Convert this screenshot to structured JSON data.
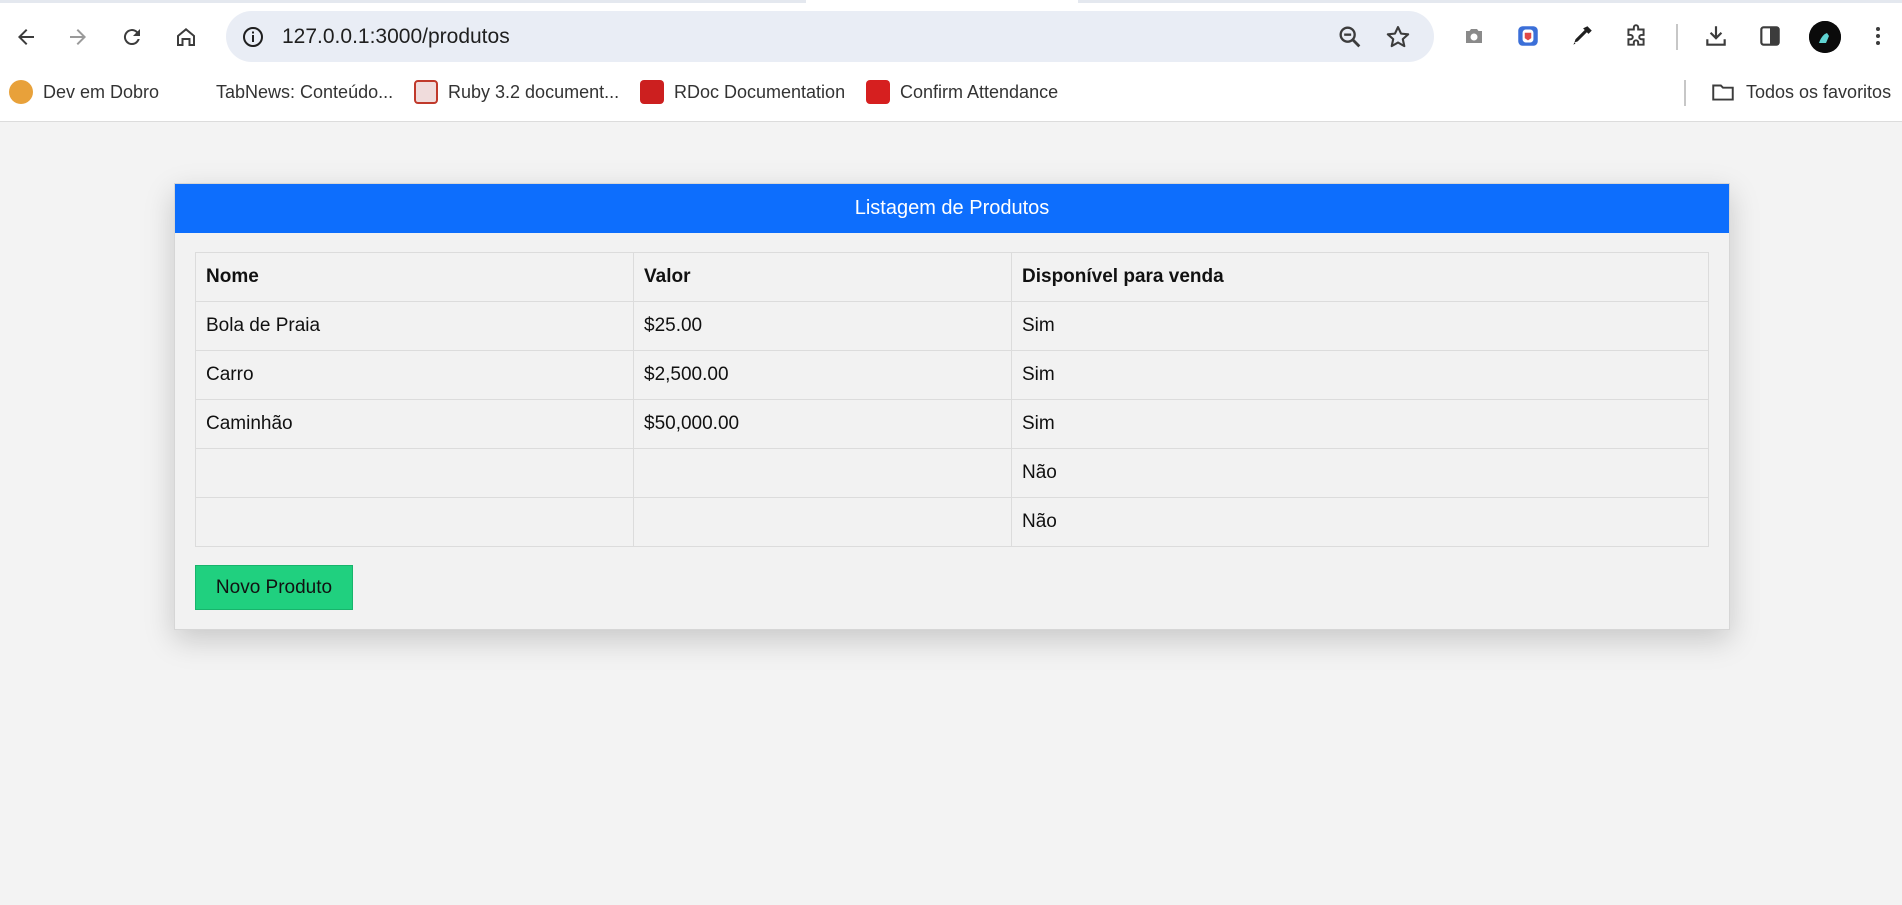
{
  "browser": {
    "url": "127.0.0.1:3000/produtos",
    "nav_icons": [
      "back-arrow-icon",
      "forward-arrow-icon",
      "reload-icon",
      "home-icon"
    ],
    "extension_icons": [
      "camera-icon",
      "extension-shield-icon",
      "eyedropper-icon",
      "puzzle-icon",
      "download-icon",
      "side-panel-icon",
      "profile-avatar",
      "menu-kebab-icon"
    ],
    "bookmarks": [
      {
        "label": "Dev em Dobro",
        "icon": "dev-em-dobro-icon",
        "color": "#e8a13a"
      },
      {
        "label": "TabNews: Conteúdo...",
        "icon": "tabnews-icon",
        "color": "#ffffff"
      },
      {
        "label": "Ruby 3.2 document...",
        "icon": "ruby-doc-icon",
        "color": "#c0392b"
      },
      {
        "label": "RDoc Documentation",
        "icon": "rdoc-icon",
        "color": "#cc1f1f"
      },
      {
        "label": "Confirm Attendance",
        "icon": "confirm-attendance-icon",
        "color": "#d61f1f"
      }
    ],
    "all_bookmarks_label": "Todos os favoritos"
  },
  "page": {
    "header_title": "Listagem de Produtos",
    "header_color": "#0d6efd",
    "table": {
      "columns": [
        "Nome",
        "Valor",
        "Disponível para venda"
      ],
      "rows": [
        [
          "Bola de Praia",
          "$25.00",
          "Sim"
        ],
        [
          "Carro",
          "$2,500.00",
          "Sim"
        ],
        [
          "Caminhão",
          "$50,000.00",
          "Sim"
        ],
        [
          "",
          "",
          "Não"
        ],
        [
          "",
          "",
          "Não"
        ]
      ]
    },
    "new_button_label": "Novo Produto",
    "new_button_color": "#20d07f"
  }
}
